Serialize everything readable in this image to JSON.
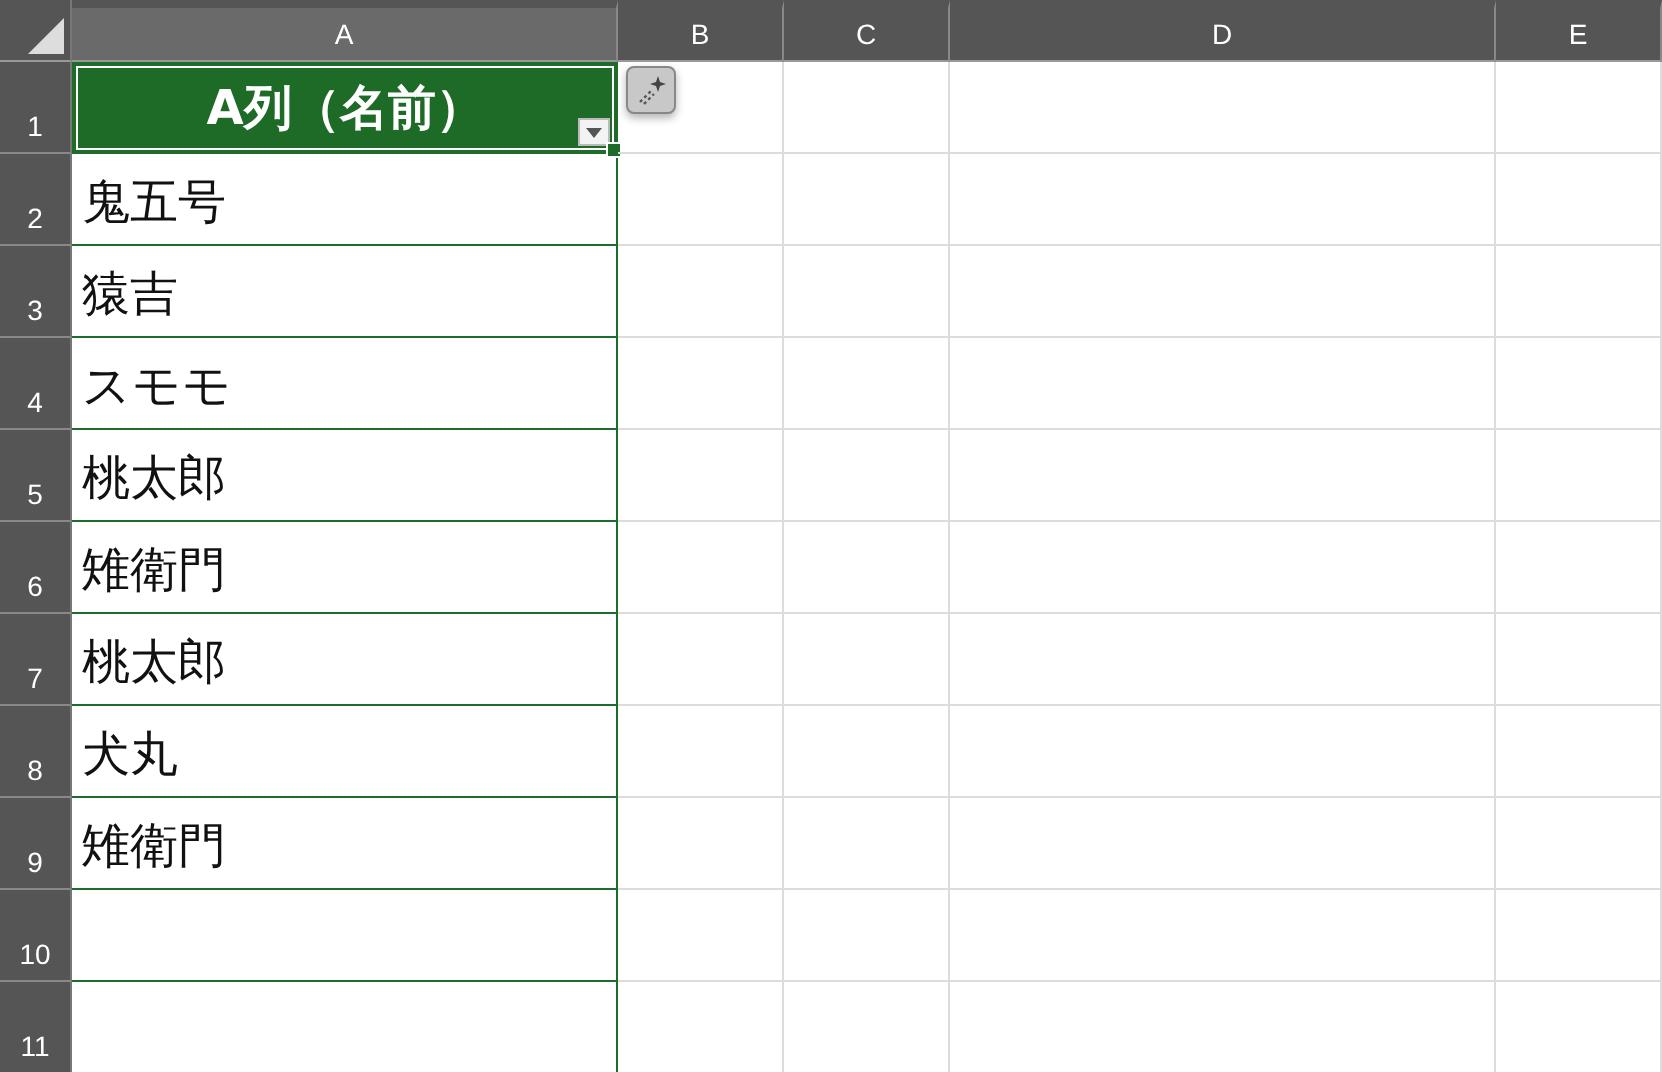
{
  "columns": [
    "A",
    "B",
    "C",
    "D",
    "E"
  ],
  "rows": [
    {
      "number": "1",
      "kind": "header",
      "name": "A列（名前）",
      "selected": true
    },
    {
      "number": "2",
      "kind": "data",
      "name": "鬼五号"
    },
    {
      "number": "3",
      "kind": "data",
      "name": "猿吉"
    },
    {
      "number": "4",
      "kind": "data",
      "name": "スモモ"
    },
    {
      "number": "5",
      "kind": "data",
      "name": "桃太郎"
    },
    {
      "number": "6",
      "kind": "data",
      "name": "雉衛門"
    },
    {
      "number": "7",
      "kind": "data",
      "name": "桃太郎"
    },
    {
      "number": "8",
      "kind": "data",
      "name": "犬丸"
    },
    {
      "number": "9",
      "kind": "data",
      "name": "雉衛門"
    },
    {
      "number": "10",
      "kind": "data"
    },
    {
      "number": "11",
      "kind": "empty"
    }
  ]
}
